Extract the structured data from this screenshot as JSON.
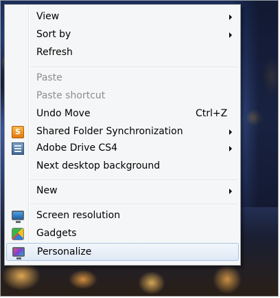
{
  "context_menu": {
    "items": [
      {
        "label": "View"
      },
      {
        "label": "Sort by"
      },
      {
        "label": "Refresh"
      },
      {
        "label": "Paste"
      },
      {
        "label": "Paste shortcut"
      },
      {
        "label": "Undo Move",
        "shortcut": "Ctrl+Z"
      },
      {
        "label": "Shared Folder Synchronization",
        "icon_text": "S"
      },
      {
        "label": "Adobe Drive CS4"
      },
      {
        "label": "Next desktop background"
      },
      {
        "label": "New"
      },
      {
        "label": "Screen resolution"
      },
      {
        "label": "Gadgets"
      },
      {
        "label": "Personalize"
      }
    ],
    "disabled_color": "#8d8d8d",
    "hover_border_color": "#a8c3e2"
  }
}
